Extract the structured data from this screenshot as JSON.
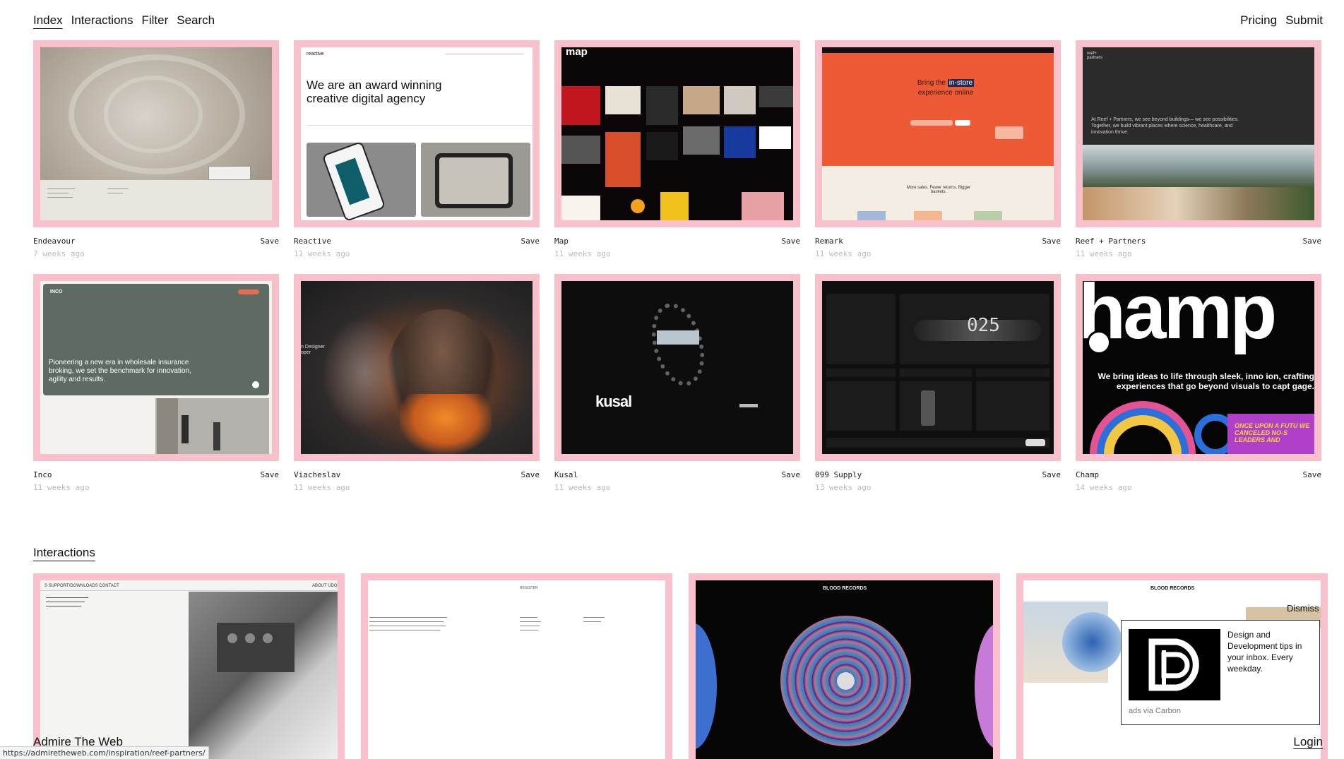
{
  "nav": {
    "left": [
      "Index",
      "Interactions",
      "Filter",
      "Search"
    ],
    "right": [
      "Pricing",
      "Submit"
    ]
  },
  "save_label": "Save",
  "sites": [
    {
      "title": "Endeavour",
      "ago": "7 weeks ago"
    },
    {
      "title": "Reactive",
      "ago": "11 weeks ago",
      "headline": "We are an award winning creative digital agency",
      "logo": "reactive"
    },
    {
      "title": "Map",
      "ago": "11 weeks ago",
      "logo": "map"
    },
    {
      "title": "Remark",
      "ago": "11 weeks ago",
      "headline_a": "Bring the",
      "headline_b": "in-store",
      "headline_c": "experience online",
      "sub": "More sales. Fewer returns. Bigger baskets."
    },
    {
      "title": "Reef + Partners",
      "ago": "11 weeks ago",
      "logo": "reef+ partners",
      "text": "At Reef + Partners, we see beyond buildings— we see possibilities. Together, we build vibrant places where science, healthcare, and innovation thrive."
    },
    {
      "title": "Inco",
      "ago": "11 weeks ago",
      "logo": "INCO",
      "headline": "Pioneering a new era in wholesale insurance broking, we set the benchmark for innovation, agility and results."
    },
    {
      "title": "Viacheslav",
      "ago": "11 weeks ago",
      "side": "n Designer oper"
    },
    {
      "title": "Kusal",
      "ago": "11 weeks ago",
      "logo": "kusal"
    },
    {
      "title": "099 Supply",
      "ago": "13 weeks ago",
      "big": "025"
    },
    {
      "title": "Champ",
      "ago": "14 weeks ago",
      "big": "hamp",
      "tagline": "We bring ideas to life through sleek, inno ion, crafting experiences that go beyond visuals to capt gage.",
      "promo": "ONCE UPON A FUTU WE CANCELED NO-S LEADERS AND"
    }
  ],
  "interactions": {
    "title": "Interactions",
    "cards": [
      {
        "nav": "S  SUPPORT/DOWNLOADS  CONTACT",
        "nav_right": "ABOUT UDO"
      },
      {
        "label": "REGISTER"
      },
      {
        "label": "BLOOD RECORDS"
      },
      {
        "label": "BLOOD RECORDS"
      }
    ]
  },
  "ad": {
    "text": "Design and Development tips in your inbox. Every weekday.",
    "via": "ads via Carbon",
    "dismiss": "Dismiss"
  },
  "footer": {
    "brand": "Admire The Web",
    "login": "Login"
  },
  "status_url": "https://admiretheweb.com/inspiration/reef-partners/"
}
